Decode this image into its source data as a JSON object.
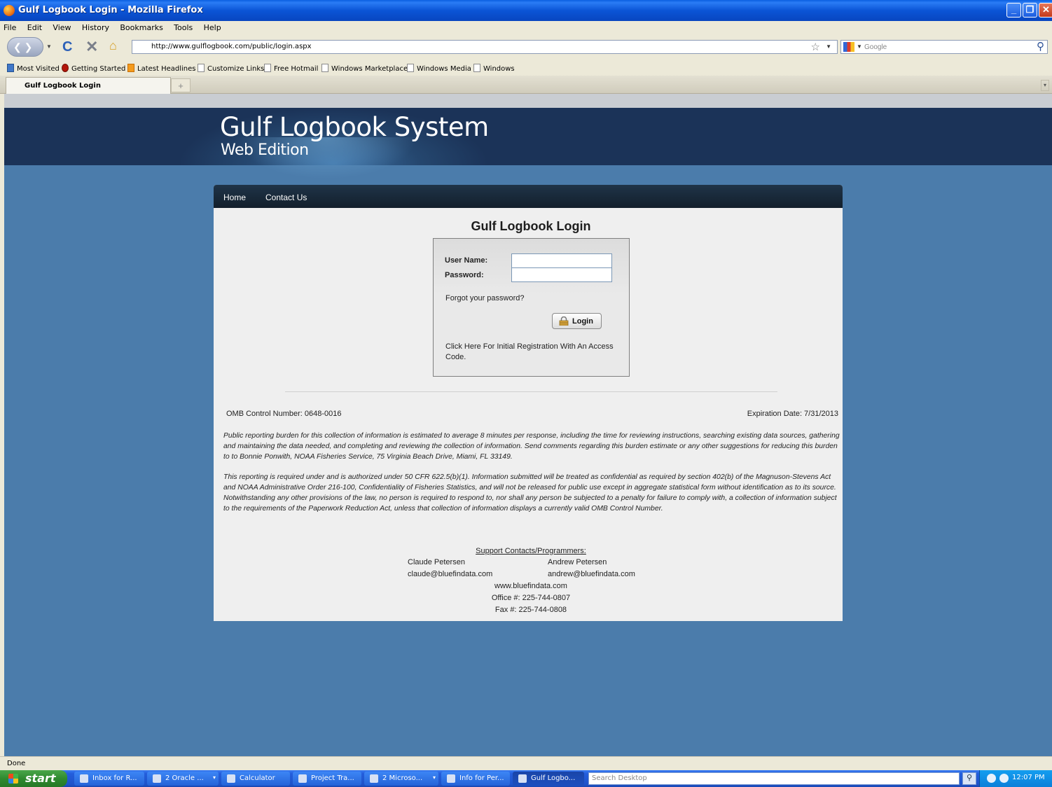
{
  "window": {
    "title": "Gulf Logbook Login - Mozilla Firefox"
  },
  "menu": [
    "File",
    "Edit",
    "View",
    "History",
    "Bookmarks",
    "Tools",
    "Help"
  ],
  "nav": {
    "url": "http://www.gulflogbook.com/public/login.aspx",
    "search_placeholder": "Google"
  },
  "bookmarks": [
    "Most Visited",
    "Getting Started",
    "Latest Headlines",
    "Customize Links",
    "Free Hotmail",
    "Windows Marketplace",
    "Windows Media",
    "Windows"
  ],
  "tabs": {
    "active": "Gulf Logbook Login",
    "new": "+"
  },
  "site": {
    "title": "Gulf Logbook System",
    "subtitle": "Web Edition",
    "menu": [
      "Home",
      "Contact Us"
    ]
  },
  "login": {
    "heading": "Gulf Logbook Login",
    "username_label": "User Name:",
    "password_label": "Password:",
    "username_value": "",
    "password_value": "",
    "forgot": "Forgot your password?",
    "button": "Login",
    "register": "Click Here For Initial Registration With An Access Code."
  },
  "omb": {
    "control": "OMB Control Number: 0648-0016",
    "expiration": "Expiration Date: 7/31/2013"
  },
  "notices": {
    "burden": "Public reporting burden for this collection of information is estimated to average 8 minutes per response, including the time for reviewing instructions, searching existing data sources, gathering and maintaining the data needed, and completing and reviewing the collection of information. Send comments regarding this burden estimate or any other suggestions for reducing this burden to to Bonnie Ponwith, NOAA Fisheries Service, 75 Virginia Beach Drive, Miami, FL 33149.",
    "authority": "This reporting is required under and is authorized under 50 CFR 622.5(b)(1).  Information submitted will be treated as confidential as required by section 402(b) of the Magnuson-Stevens Act and NOAA Administrative Order 216-100, Confidentiality of Fisheries Statistics, and will not be released for public use except in aggregate statistical form without identification as to its source. Notwithstanding any other provisions of the law, no person is required to respond to, nor shall any person be subjected to a penalty for failure to comply with, a collection of information subject to the requirements of the Paperwork Reduction Act, unless that collection of information displays a currently valid OMB Control Number."
  },
  "support": {
    "heading": "Support Contacts/Programmers:",
    "contact1_name": "Claude Petersen",
    "contact1_email": "claude@bluefindata.com",
    "contact2_name": "Andrew Petersen",
    "contact2_email": "andrew@bluefindata.com",
    "website": "www.bluefindata.com",
    "office": "Office #: 225-744-0807",
    "fax": "Fax #: 225-744-0808"
  },
  "status": "Done",
  "taskbar": {
    "start": "start",
    "tasks": [
      "Inbox for R...",
      "2 Oracle ...",
      "Calculator",
      "Project Tra...",
      "2 Microso...",
      "Info for Per...",
      "Gulf Logbo..."
    ],
    "search_placeholder": "Search Desktop",
    "clock": "12:07 PM"
  },
  "colors": {
    "page_bg": "#4b7cab",
    "banner": "#1b3358",
    "content_bg": "#efefef",
    "menu_strip": "#1b2b3b"
  }
}
